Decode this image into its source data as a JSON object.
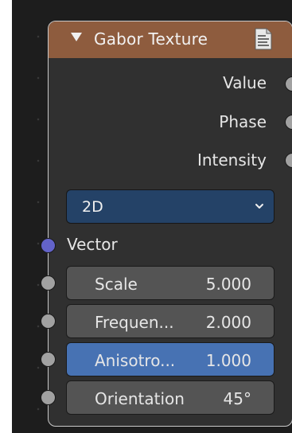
{
  "node": {
    "title": "Gabor Texture",
    "header_color": "#8e5c3e",
    "icons": {
      "collapse": "triangle-down-icon",
      "preview": "document-icon"
    }
  },
  "outputs": [
    {
      "label": "Value"
    },
    {
      "label": "Phase"
    },
    {
      "label": "Intensity"
    }
  ],
  "type_dropdown": {
    "value": "2D",
    "icon": "chevron-down-icon"
  },
  "inputs": {
    "vector_label": "Vector",
    "vector_socket_color": "#6363c9",
    "fields": [
      {
        "label": "Scale",
        "value": "5.000",
        "selected": false
      },
      {
        "label": "Frequen...",
        "value": "2.000",
        "selected": false
      },
      {
        "label": "Anisotro...",
        "value": "1.000",
        "selected": true
      },
      {
        "label": "Orientation",
        "value": "45°",
        "selected": false
      }
    ]
  },
  "colors": {
    "selected_field": "#4772b3",
    "dropdown": "#244267",
    "socket": "#a1a1a1"
  }
}
